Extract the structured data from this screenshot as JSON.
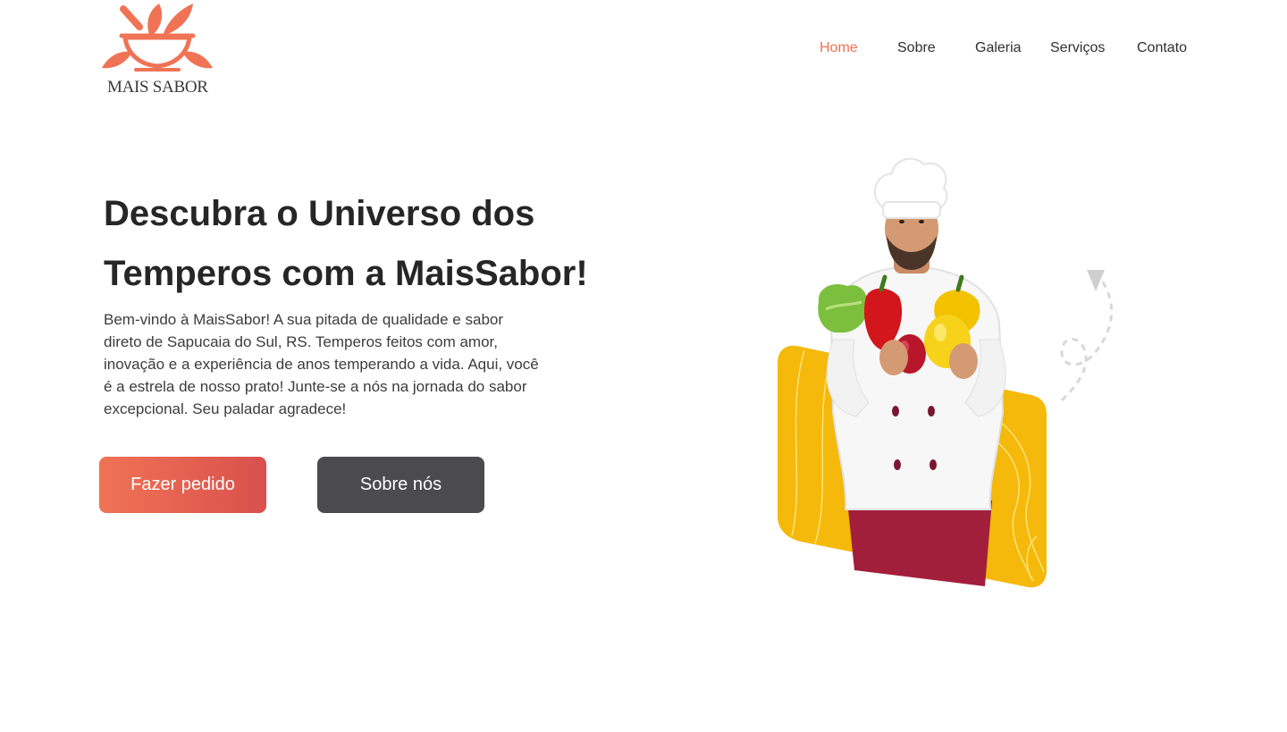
{
  "brand": {
    "name": "MAIS SABOR",
    "logo_icon": "mortar-leaves-icon",
    "accent_color": "#f07355"
  },
  "nav": {
    "items": [
      {
        "label": "Home",
        "active": true
      },
      {
        "label": "Sobre",
        "active": false
      },
      {
        "label": "Galeria",
        "active": false
      },
      {
        "label": "Serviços",
        "active": false
      },
      {
        "label": "Contato",
        "active": false
      }
    ]
  },
  "hero": {
    "title": "Descubra o Universo dos Temperos com a MaisSabor!",
    "description": "Bem-vindo à MaisSabor! A sua pitada de qualidade e sabor direto de Sapucaia do Sul, RS. Temperos feitos com amor, inovação e a experiência de anos temperando a vida. Aqui, você é a estrela de nosso prato! Junte-se a nós na jornada do sabor excepcional. Seu paladar agradece!",
    "primary_button": "Fazer pedido",
    "secondary_button": "Sobre nós",
    "image": "chef-holding-vegetables",
    "colors": {
      "primary_button": "#e8624f",
      "secondary_button": "#4a4a4f",
      "illustration_background": "#f4b90a"
    }
  }
}
